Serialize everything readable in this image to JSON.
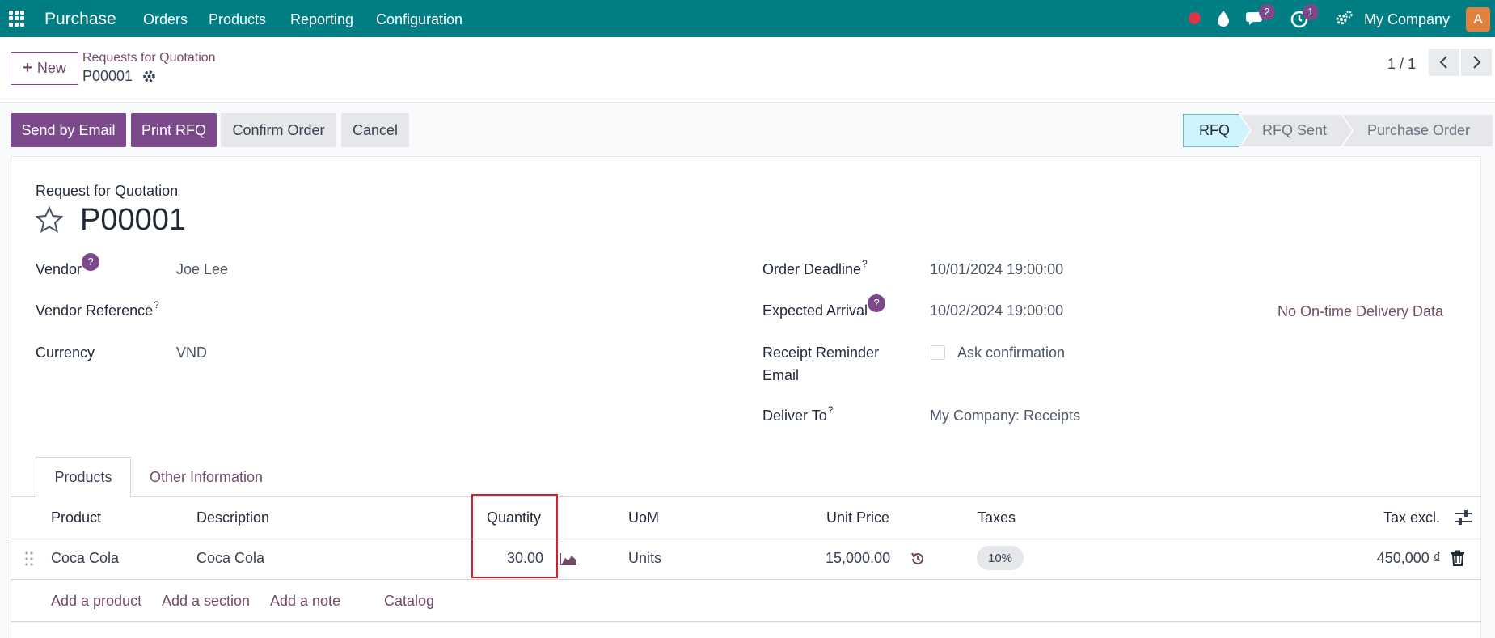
{
  "navbar": {
    "brand": "Purchase",
    "menu": [
      "Orders",
      "Products",
      "Reporting",
      "Configuration"
    ],
    "messages_count": "2",
    "activities_count": "1",
    "company": "My Company",
    "avatar_initial": "A"
  },
  "control": {
    "new_label": "New",
    "breadcrumb": "Requests for Quotation",
    "record": "P00001",
    "pager": "1 / 1"
  },
  "actions": {
    "send_email": "Send by Email",
    "print_rfq": "Print RFQ",
    "confirm": "Confirm Order",
    "cancel": "Cancel"
  },
  "statusbar": {
    "stages": [
      "RFQ",
      "RFQ Sent",
      "Purchase Order"
    ],
    "active": "RFQ"
  },
  "form": {
    "doc_type": "Request for Quotation",
    "title": "P00001",
    "vendor_label": "Vendor",
    "vendor": "Joe Lee",
    "vendor_ref_label": "Vendor Reference",
    "currency_label": "Currency",
    "currency": "VND",
    "deadline_label": "Order Deadline",
    "deadline": "10/01/2024 19:00:00",
    "arrival_label": "Expected Arrival",
    "arrival": "10/02/2024 19:00:00",
    "ontime": "No On-time Delivery Data",
    "reminder_label_1": "Receipt Reminder",
    "reminder_label_2": "Email",
    "ask_confirmation": "Ask confirmation",
    "deliver_to_label": "Deliver To",
    "deliver_to": "My Company: Receipts",
    "help_mark": "?"
  },
  "tabs": [
    "Products",
    "Other Information"
  ],
  "table": {
    "headers": {
      "product": "Product",
      "description": "Description",
      "quantity": "Quantity",
      "uom": "UoM",
      "unit_price": "Unit Price",
      "taxes": "Taxes",
      "subtotal": "Tax excl."
    },
    "row": {
      "product": "Coca Cola",
      "description": "Coca Cola",
      "quantity": "30.00",
      "uom": "Units",
      "unit_price": "15,000.00",
      "tax": "10%",
      "subtotal": "450,000 ₫"
    },
    "add_links": [
      "Add a product",
      "Add a section",
      "Add a note",
      "Catalog"
    ]
  },
  "colors": {
    "navbar": "#017e84",
    "primary": "#7c4a8c",
    "highlight": "#d3202a"
  }
}
